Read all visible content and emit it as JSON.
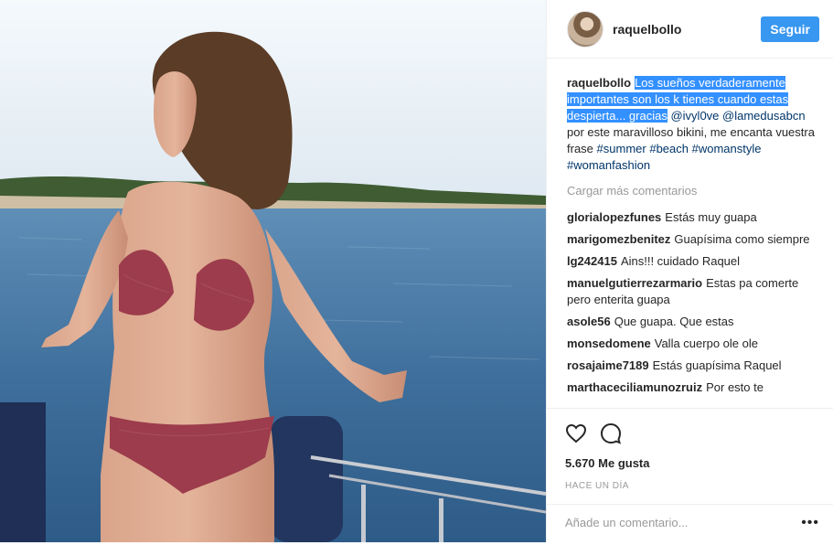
{
  "post": {
    "username": "raquelbollo",
    "follow_label": "Seguir",
    "caption": {
      "username": "raquelbollo",
      "highlighted_text": "Los sueños verdaderamente importantes son los k tienes cuando estas despierta... gracias",
      "mention_1": "@ivyl0ve",
      "mention_2": "@lamedusabcn",
      "text_middle": "por este maravilloso bikini, me encanta vuestra frase",
      "hashtags": [
        "#summer",
        "#beach",
        "#womanstyle",
        "#womanfashion"
      ]
    },
    "load_more_label": "Cargar más comentarios",
    "comments": [
      {
        "user": "glorialopezfunes",
        "text": "Estás muy guapa"
      },
      {
        "user": "marigomezbenitez",
        "text": "Guapísima como siempre"
      },
      {
        "user": "lg242415",
        "text": "Ains!!! cuidado Raquel"
      },
      {
        "user": "manuelgutierrezarmario",
        "text": "Estas pa comerte pero enterita guapa"
      },
      {
        "user": "asole56",
        "text": "Que guapa. Que estas"
      },
      {
        "user": "monsedomene",
        "text": "Valla cuerpo ole ole"
      },
      {
        "user": "rosajaime7189",
        "text": "Estás guapísima Raquel"
      },
      {
        "user": "marthaceciliamunozruiz",
        "text": "Por esto te"
      }
    ],
    "likes": "5.670 Me gusta",
    "time": "HACE UN DÍA",
    "comment_placeholder": "Añade un comentario...",
    "more_options": "•••",
    "icons": {
      "like": "heart-icon",
      "comment": "speech-bubble-icon",
      "options": "more-options-icon"
    },
    "colors": {
      "follow_button": "#3897f0",
      "selection_highlight": "#3390ff",
      "link": "#003569",
      "muted": "#999999"
    }
  }
}
